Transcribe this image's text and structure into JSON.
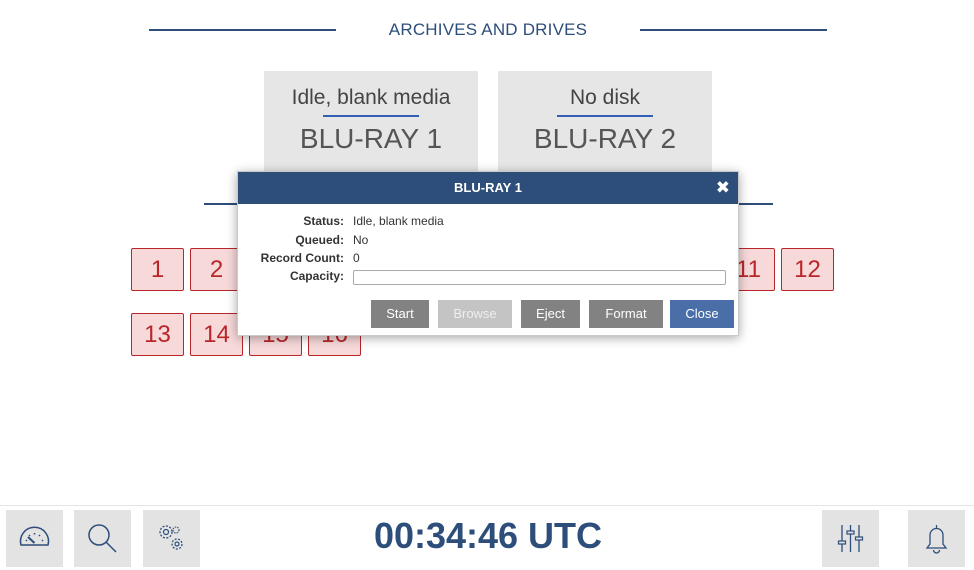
{
  "section": {
    "title": "ARCHIVES AND DRIVES"
  },
  "drives": [
    {
      "status": "Idle, blank media",
      "name": "BLU-RAY 1"
    },
    {
      "status": "No disk",
      "name": "BLU-RAY 2"
    }
  ],
  "slots": [
    "1",
    "2",
    "11",
    "12",
    "13",
    "14",
    "15",
    "16"
  ],
  "dialog": {
    "title": "BLU-RAY 1",
    "close_symbol": "✖",
    "fields": {
      "status_label": "Status:",
      "status_value": "Idle, blank media",
      "queued_label": "Queued:",
      "queued_value": "No",
      "record_count_label": "Record Count:",
      "record_count_value": "0",
      "capacity_label": "Capacity:"
    },
    "capacity_fraction": 0,
    "buttons": {
      "start": "Start",
      "browse": "Browse",
      "eject": "Eject",
      "format": "Format",
      "close": "Close"
    }
  },
  "clock": "00:34:46 UTC",
  "toolbar": {
    "left_icons": [
      "gauge-icon",
      "search-icon",
      "gears-icon"
    ],
    "right_icons": [
      "sliders-icon",
      "bell-icon"
    ]
  },
  "colors": {
    "accent": "#2d4d7a",
    "slot_border": "#b9262a",
    "slot_fill": "#f7d9da",
    "primary_button": "#4a6ea8"
  }
}
